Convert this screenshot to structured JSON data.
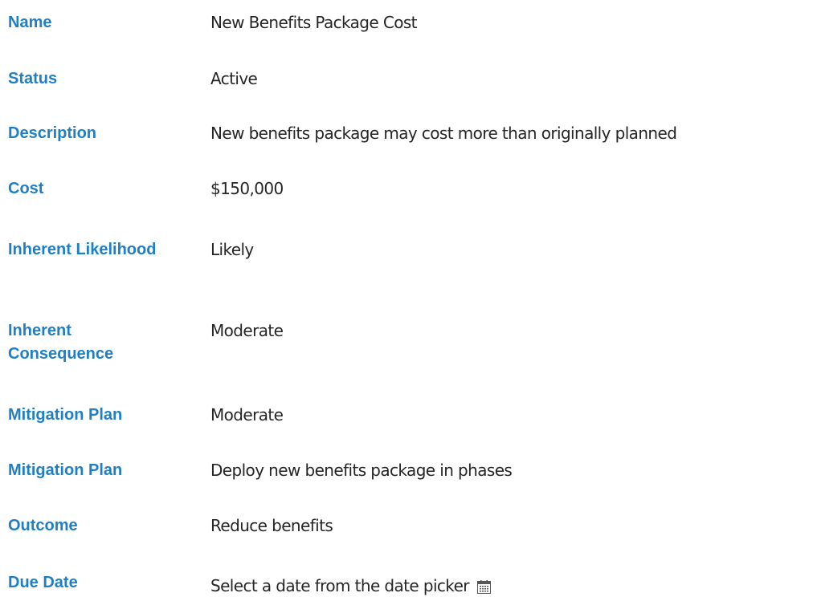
{
  "fields": [
    {
      "label": "Name",
      "value": "New Benefits Package Cost"
    },
    {
      "label": "Status",
      "value": "Active"
    },
    {
      "label": "Description",
      "value": "New benefits package may cost more than originally planned"
    },
    {
      "label": "Cost",
      "value": "$150,000"
    },
    {
      "label": "Inherent Likelihood",
      "value": "Likely"
    },
    {
      "label": "Inherent Consequence",
      "value": "Moderate"
    },
    {
      "label": "Mitigation Plan",
      "value": "Moderate"
    },
    {
      "label": "Mitigation Plan",
      "value": "Deploy new benefits package in phases"
    },
    {
      "label": "Outcome",
      "value": "Reduce benefits"
    },
    {
      "label": "Due Date",
      "value": "Select a date from the date picker",
      "icon": "calendar-icon"
    }
  ],
  "colors": {
    "label": "#1f7fc4",
    "value": "#252525",
    "background": "#ffffff"
  }
}
